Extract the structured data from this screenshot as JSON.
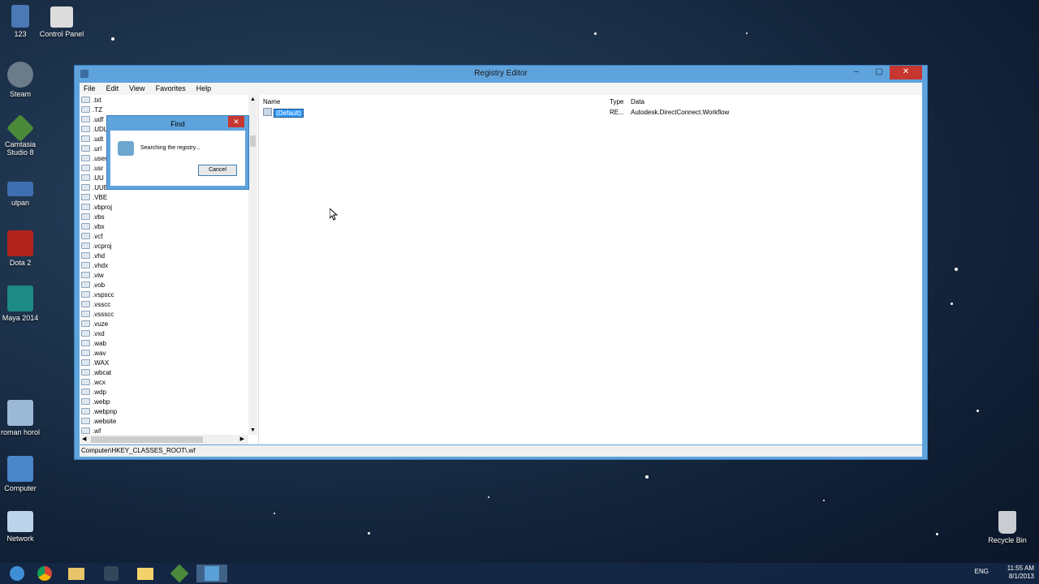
{
  "desktop": {
    "icons_left": [
      {
        "label": "123",
        "icon": "user-folder-icon"
      },
      {
        "label": "Control Panel",
        "icon": "control-panel-icon"
      },
      {
        "label": "Steam",
        "icon": "steam-icon"
      },
      {
        "label": "Camtasia Studio 8",
        "icon": "camtasia-icon"
      },
      {
        "label": "ulpan",
        "icon": "app-icon"
      },
      {
        "label": "Dota 2",
        "icon": "dota-icon"
      },
      {
        "label": "Maya 2014",
        "icon": "maya-icon"
      },
      {
        "label": "roman horol",
        "icon": "user-folder-icon"
      },
      {
        "label": "Computer",
        "icon": "computer-icon"
      },
      {
        "label": "Network",
        "icon": "network-icon"
      }
    ],
    "icon_right": {
      "label": "Recycle Bin",
      "icon": "recycle-bin-icon"
    }
  },
  "window": {
    "title": "Registry Editor",
    "minimize": "–",
    "maximize": "▢",
    "close": "✕",
    "menu": [
      "File",
      "Edit",
      "View",
      "Favorites",
      "Help"
    ],
    "tree_items": [
      ".txt",
      ".TZ",
      ".udf",
      ".UDL",
      ".udt",
      ".url",
      ".user",
      ".usr",
      ".UU",
      ".UUE",
      ".VBE",
      ".vbproj",
      ".vbs",
      ".vbx",
      ".vcf",
      ".vcproj",
      ".vhd",
      ".vhdx",
      ".viw",
      ".vob",
      ".vspscc",
      ".vsscc",
      ".vssscc",
      ".vuze",
      ".vxd",
      ".wab",
      ".wav",
      ".WAX",
      ".wbcat",
      ".wcx",
      ".wdp",
      ".webp",
      ".webpnp",
      ".website",
      ".wf"
    ],
    "columns": {
      "name": "Name",
      "type": "Type",
      "data": "Data"
    },
    "values": [
      {
        "name": "(Default)",
        "type": "RE...",
        "data": "Autodesk.DirectConnect.Workflow"
      }
    ],
    "status": "Computer\\HKEY_CLASSES_ROOT\\.wf"
  },
  "find_dialog": {
    "title": "Find",
    "message": "Searching the registry...",
    "cancel": "Cancel",
    "close": "✕"
  },
  "taskbar": {
    "lang": "ENG",
    "time": "11:55 AM",
    "date": "8/1/2013",
    "apps": [
      "windows-start-icon",
      "chrome-icon",
      "file-explorer-icon",
      "steam-icon",
      "folder-icon",
      "camtasia-icon",
      "registry-editor-icon"
    ]
  },
  "colors": {
    "window_frame": "#5fa3dd",
    "close_red": "#c7372f",
    "selection": "#3399ff"
  }
}
